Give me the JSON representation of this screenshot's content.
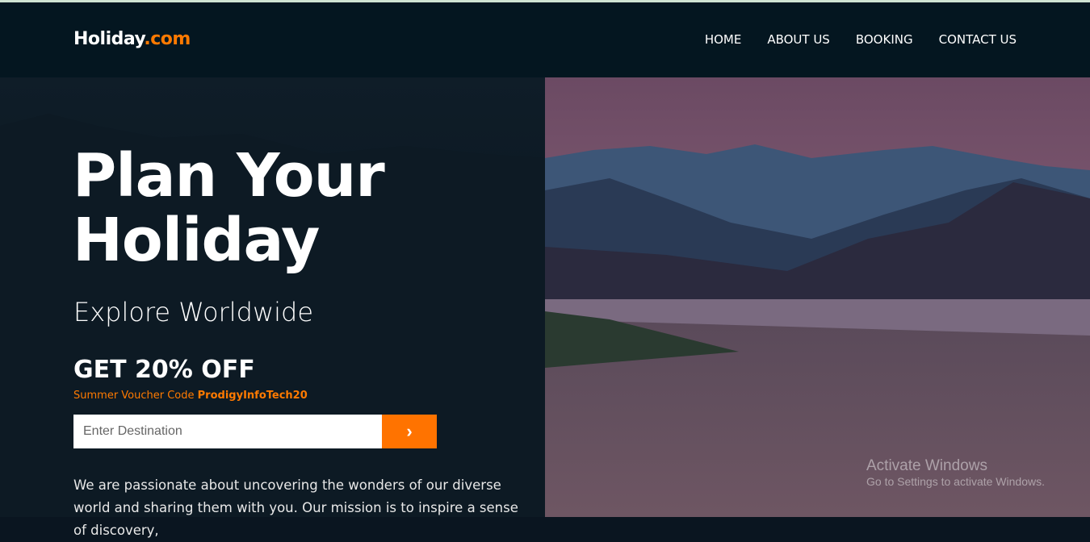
{
  "header": {
    "logo_main": "Holiday",
    "logo_accent": ".com",
    "nav": [
      "HOME",
      "ABOUT US",
      "BOOKING",
      "CONTACT US"
    ]
  },
  "hero": {
    "title_line1": "Plan Your",
    "title_line2": "Holiday",
    "subtitle": "Explore Worldwide",
    "offer": "GET 20% OFF",
    "voucher_label": "Summer Voucher Code",
    "voucher_code": "ProdigyInfoTech20",
    "search_placeholder": "Enter Destination",
    "submit_icon": "chevron-right-icon",
    "paragraph": "We are passionate about uncovering the wonders of our diverse world and sharing them with you. Our mission is to inspire a sense of discovery,"
  },
  "watermark": {
    "title": "Activate Windows",
    "subtitle": "Go to Settings to activate Windows."
  },
  "colors": {
    "accent": "#ff7a00",
    "header_bg": "#041620"
  }
}
